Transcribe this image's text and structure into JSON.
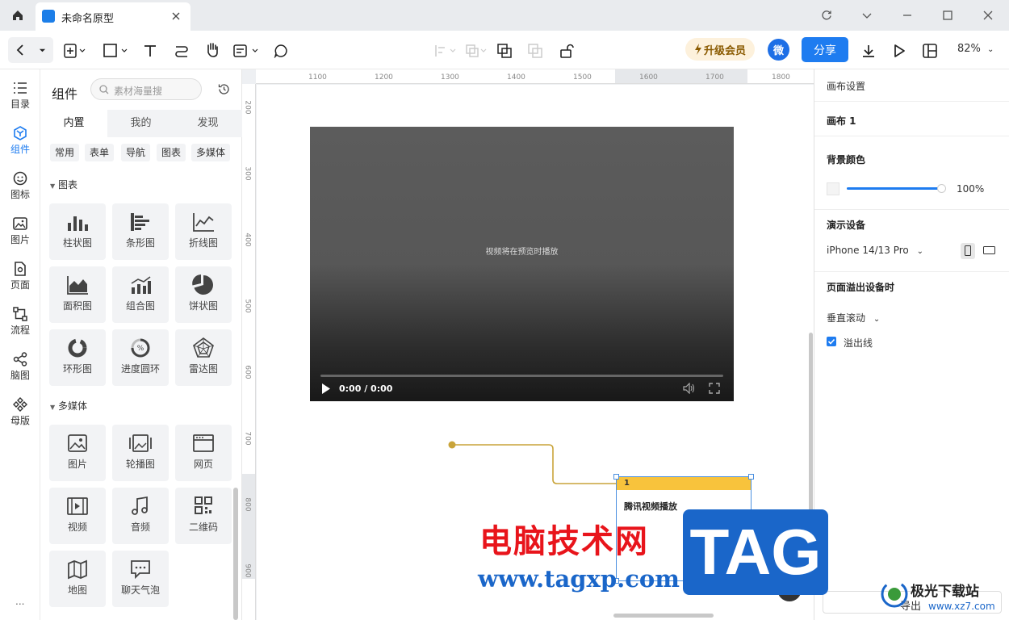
{
  "titlebar": {
    "doc_title": "未命名原型"
  },
  "toolbar": {
    "upgrade_label": "升级会员",
    "avatar_label": "微",
    "share_label": "分享",
    "zoom": "82%"
  },
  "leftnav": {
    "items": [
      {
        "label": "目录",
        "icon": "list-icon"
      },
      {
        "label": "组件",
        "icon": "component-icon"
      },
      {
        "label": "图标",
        "icon": "smiley-icon"
      },
      {
        "label": "图片",
        "icon": "image-icon"
      },
      {
        "label": "页面",
        "icon": "page-icon"
      },
      {
        "label": "流程",
        "icon": "flow-icon"
      },
      {
        "label": "脑图",
        "icon": "mindmap-icon"
      },
      {
        "label": "母版",
        "icon": "master-icon"
      }
    ],
    "more": "..."
  },
  "panel": {
    "title": "组件",
    "search_placeholder": "素材海量搜",
    "tabs": [
      "内置",
      "我的",
      "发现"
    ],
    "categories": [
      "常用",
      "表单",
      "导航",
      "图表",
      "多媒体"
    ],
    "section_charts": "图表",
    "charts": [
      "柱状图",
      "条形图",
      "折线图",
      "面积图",
      "组合图",
      "饼状图",
      "环形图",
      "进度圆环",
      "雷达图"
    ],
    "section_media": "多媒体",
    "media": [
      "图片",
      "轮播图",
      "网页",
      "视频",
      "音频",
      "二维码",
      "地图",
      "聊天气泡"
    ]
  },
  "ruler": {
    "h": [
      "1100",
      "1200",
      "1300",
      "1400",
      "1500",
      "1600",
      "1700",
      "1800"
    ],
    "v": [
      "200",
      "300",
      "400",
      "500",
      "600",
      "700",
      "800",
      "900"
    ]
  },
  "canvas": {
    "video_message": "视频将在预览时播放",
    "video_time": "0:00 / 0:00",
    "note_number": "1",
    "note_text": "腾讯视频播放"
  },
  "rpanel": {
    "canvas_settings": "画布设置",
    "canvas_name": "画布 1",
    "bg_color_label": "背景颜色",
    "opacity": "100%",
    "device_label": "演示设备",
    "device_value": "iPhone 14/13 Pro",
    "overflow_label": "页面溢出设备时",
    "scroll_value": "垂直滚动",
    "overflow_line_label": "溢出线",
    "overflow_line_checked": true,
    "export_label": "导出"
  },
  "watermark": {
    "line1": "电脑技术网",
    "line2": "www.tagxp.com",
    "tag": "TAG",
    "site_cn": "极光下载站",
    "site_url": "www.xz7.com"
  },
  "colors": {
    "accent": "#1e7cf0",
    "note_header": "#f8c33c",
    "connector": "#c9a43a",
    "upgrade_bg": "#fdf1dc"
  }
}
